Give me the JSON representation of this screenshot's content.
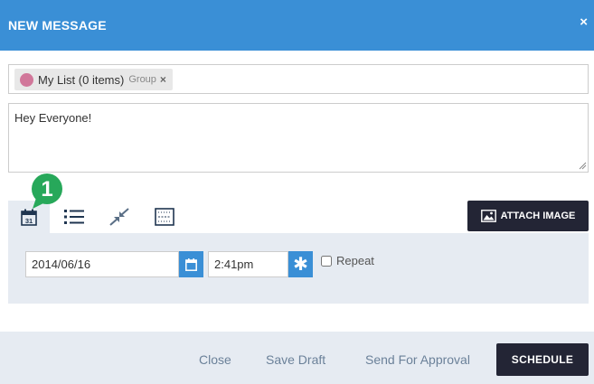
{
  "header": {
    "title": "NEW MESSAGE",
    "close_glyph": "×"
  },
  "recipients": {
    "chips": [
      {
        "name": "My List (0 items)",
        "type": "Group",
        "remove_glyph": "×",
        "color": "#d1779a"
      }
    ]
  },
  "message": {
    "value": "Hey Everyone!"
  },
  "badge": {
    "number": "1",
    "color": "#27a85a"
  },
  "tabs": [
    {
      "icon": "calendar-icon",
      "active": true
    },
    {
      "icon": "list-icon",
      "active": false
    },
    {
      "icon": "shrink-icon",
      "active": false
    },
    {
      "icon": "barcode-icon",
      "active": false
    }
  ],
  "attach": {
    "label": "ATTACH IMAGE",
    "icon": "image-icon"
  },
  "schedule": {
    "date": "2014/06/16",
    "time": "2:41pm",
    "time_glyph": "✱",
    "repeat_label": "Repeat",
    "repeat_checked": false
  },
  "footer": {
    "close_label": "Close",
    "save_draft_label": "Save Draft",
    "send_approval_label": "Send For Approval",
    "schedule_label": "SCHEDULE"
  },
  "colors": {
    "accent": "#3a8fd6",
    "dark_button": "#232535",
    "panel": "#e6ebf2"
  }
}
